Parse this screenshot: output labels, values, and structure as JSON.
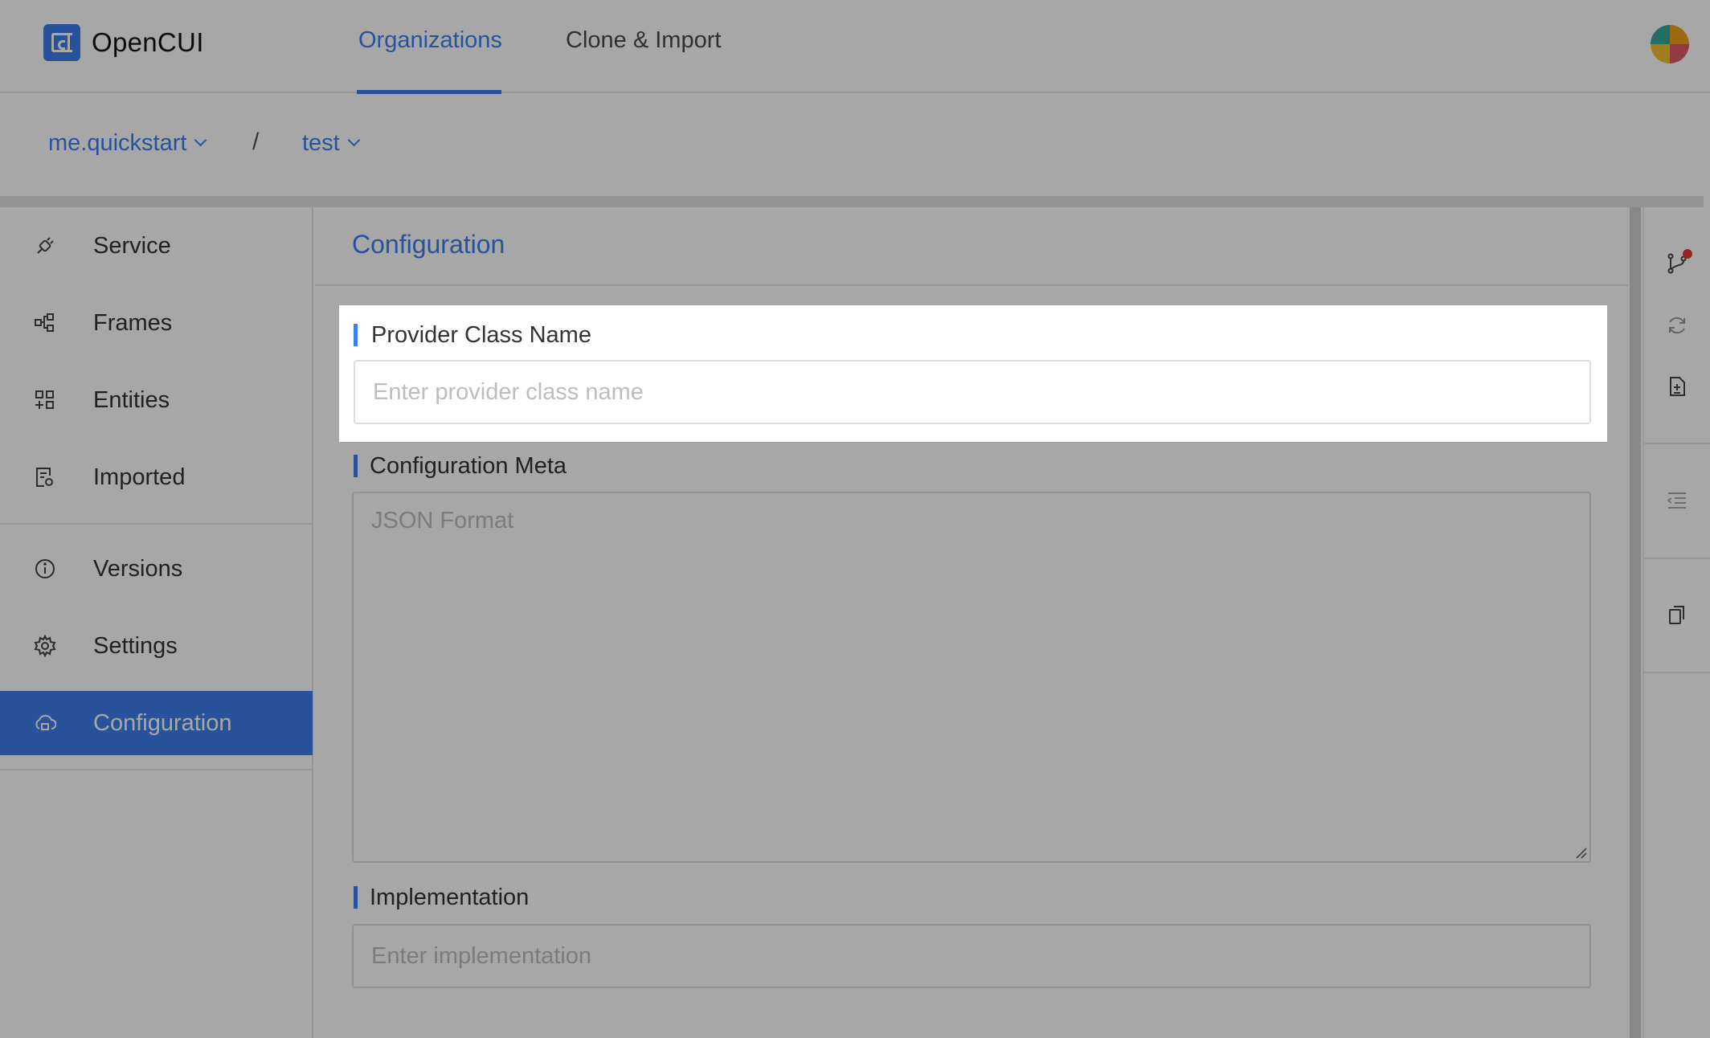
{
  "app": {
    "logo_text": "OpenCUI",
    "accent": "#3d7fec"
  },
  "header": {
    "tabs": [
      {
        "label": "Organizations",
        "active": true
      },
      {
        "label": "Clone & Import",
        "active": false
      }
    ]
  },
  "breadcrumb": {
    "org": "me.quickstart",
    "separator": "/",
    "project": "test"
  },
  "sidebar": {
    "items": [
      {
        "label": "Service",
        "icon": "plug-icon"
      },
      {
        "label": "Frames",
        "icon": "frames-icon"
      },
      {
        "label": "Entities",
        "icon": "entities-icon"
      },
      {
        "label": "Imported",
        "icon": "imported-icon"
      },
      {
        "label": "Versions",
        "icon": "info-icon"
      },
      {
        "label": "Settings",
        "icon": "gear-icon"
      },
      {
        "label": "Configuration",
        "icon": "cloud-icon",
        "active": true
      }
    ]
  },
  "main": {
    "title": "Configuration",
    "provider": {
      "label": "Provider Class Name",
      "placeholder": "Enter provider class name",
      "value": ""
    },
    "meta": {
      "label": "Configuration Meta",
      "placeholder": "JSON Format",
      "value": ""
    },
    "implementation": {
      "label": "Implementation",
      "placeholder": "Enter implementation",
      "value": ""
    }
  },
  "right_toolbar": {
    "icons": [
      "branch-icon",
      "refresh-icon",
      "document-add-icon",
      "outdent-icon",
      "copy-icon"
    ]
  }
}
